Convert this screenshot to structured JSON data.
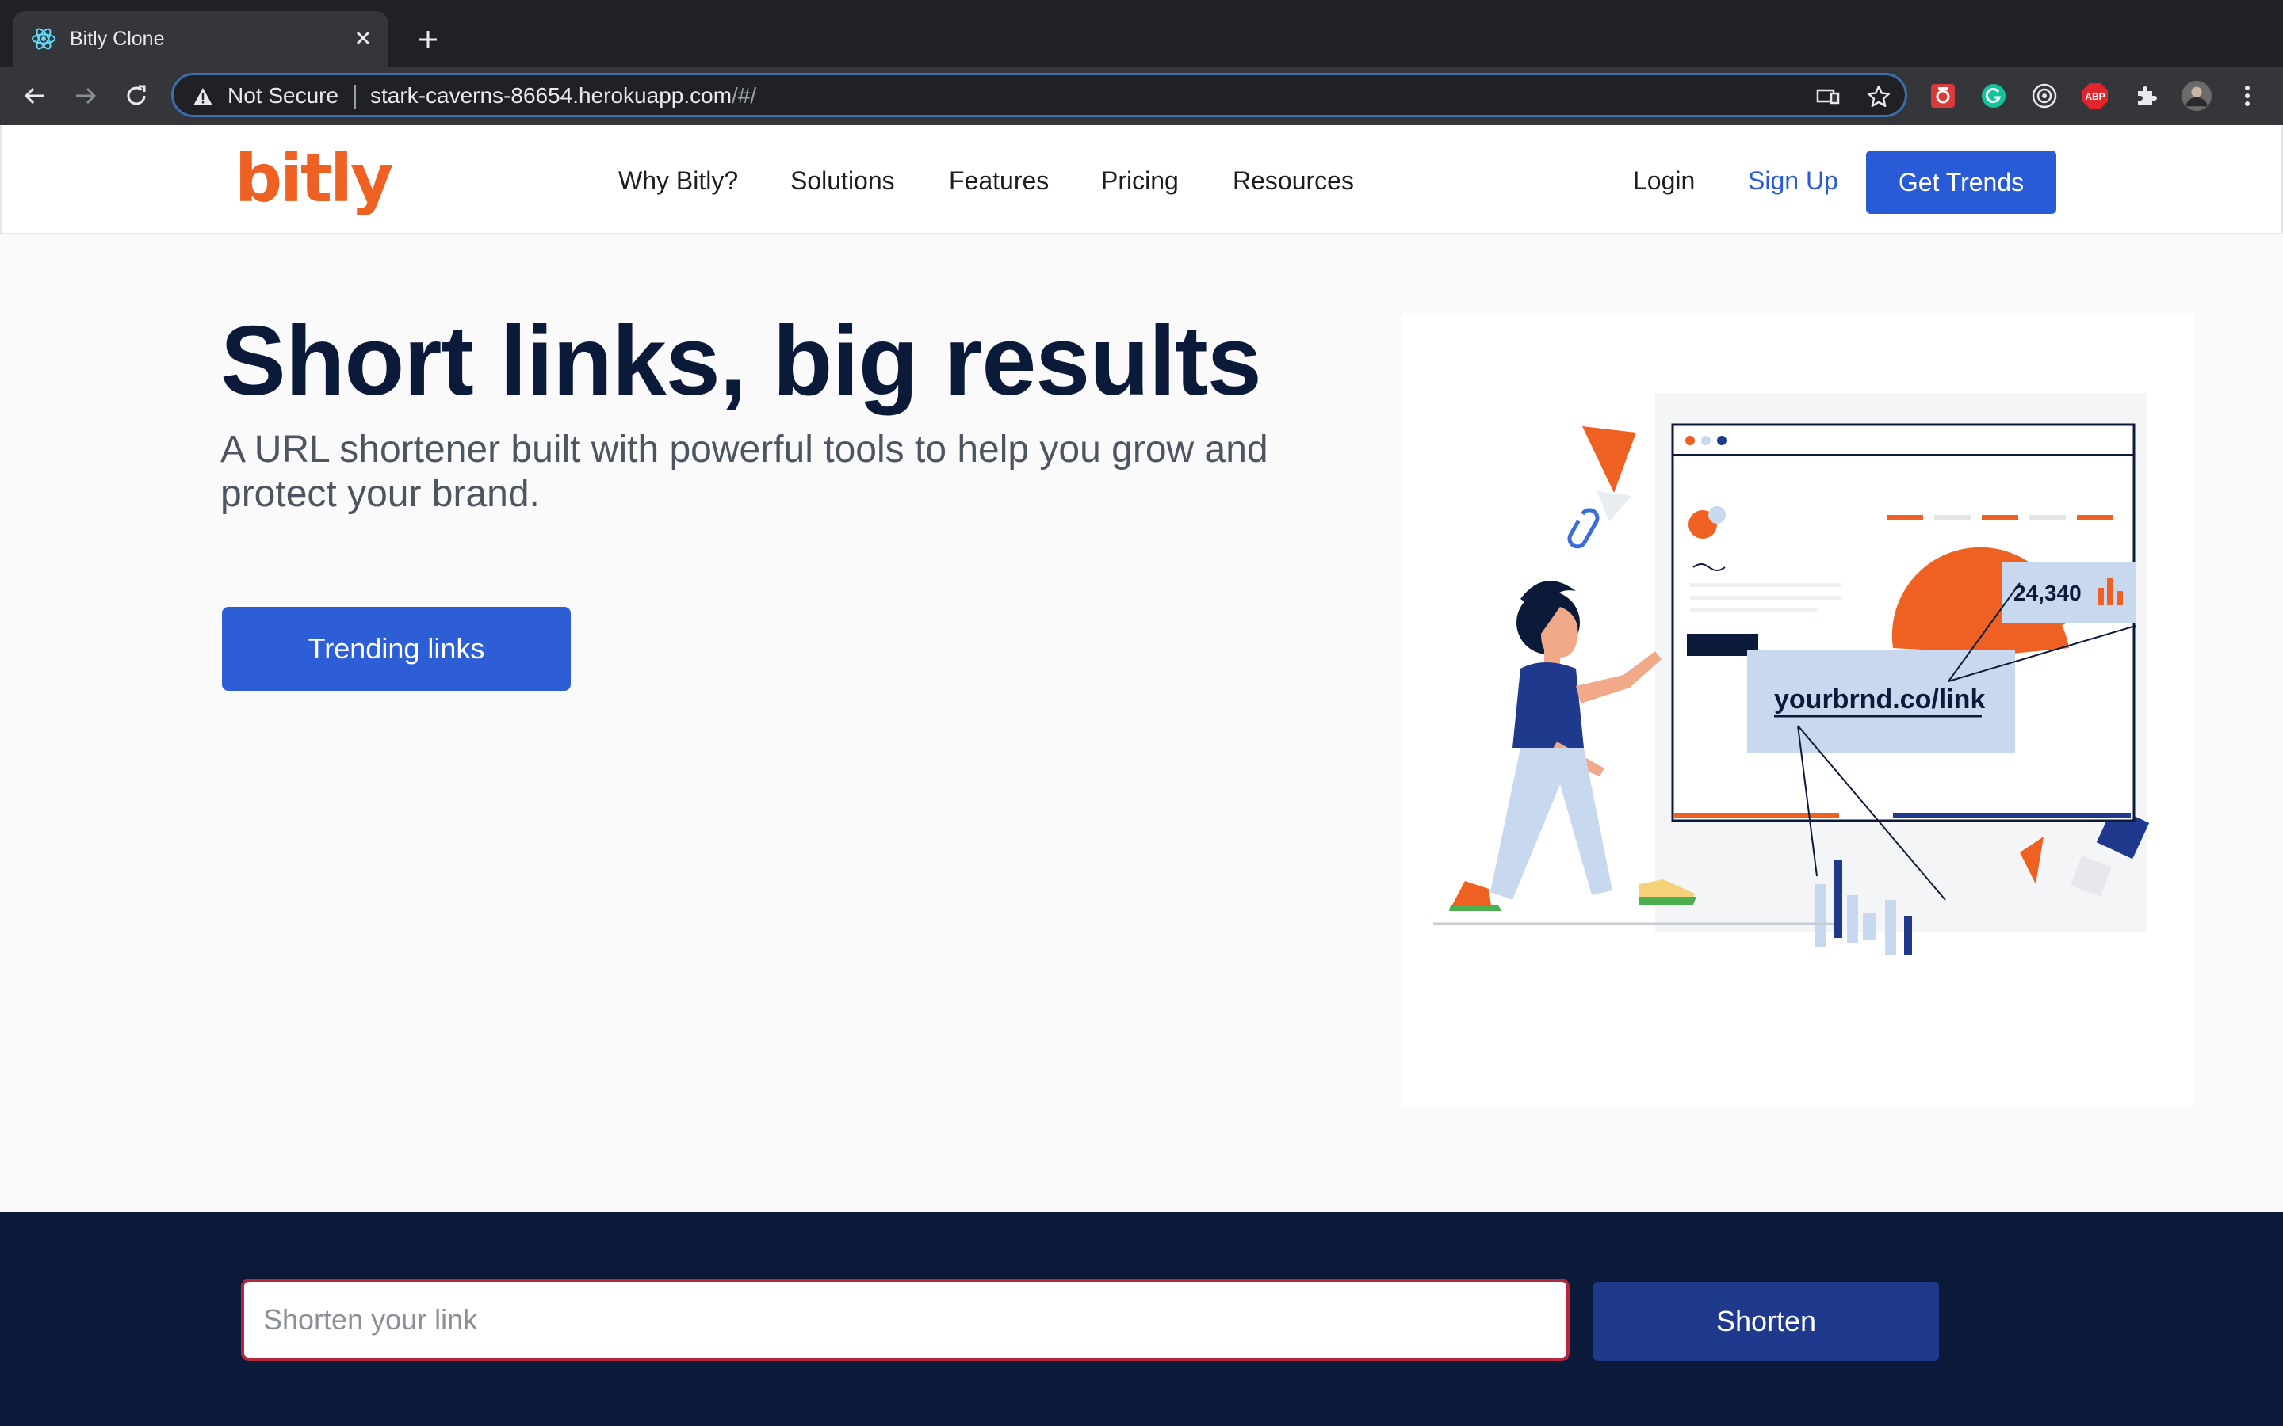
{
  "browser": {
    "tab_title": "Bitly Clone",
    "security_label": "Not Secure",
    "url_host": "stark-caverns-86654.herokuapp.com",
    "url_path": "/#/",
    "extension_abp_label": "ABP"
  },
  "header": {
    "logo_text": "bitly",
    "nav": [
      "Why Bitly?",
      "Solutions",
      "Features",
      "Pricing",
      "Resources"
    ],
    "login_label": "Login",
    "signup_label": "Sign Up",
    "cta_label": "Get Trends"
  },
  "hero": {
    "title": "Short links, big results",
    "subtitle": "A URL shortener built with powerful tools to help you grow and protect your brand.",
    "button_label": "Trending links",
    "illustration": {
      "stat_value": "24,340",
      "link_text": "yourbrnd.co/link"
    }
  },
  "shortener": {
    "placeholder": "Shorten your link",
    "button_label": "Shorten"
  },
  "colors": {
    "brand_orange": "#ee6123",
    "primary_blue": "#2a5bd7",
    "navy": "#0c1a3a"
  }
}
